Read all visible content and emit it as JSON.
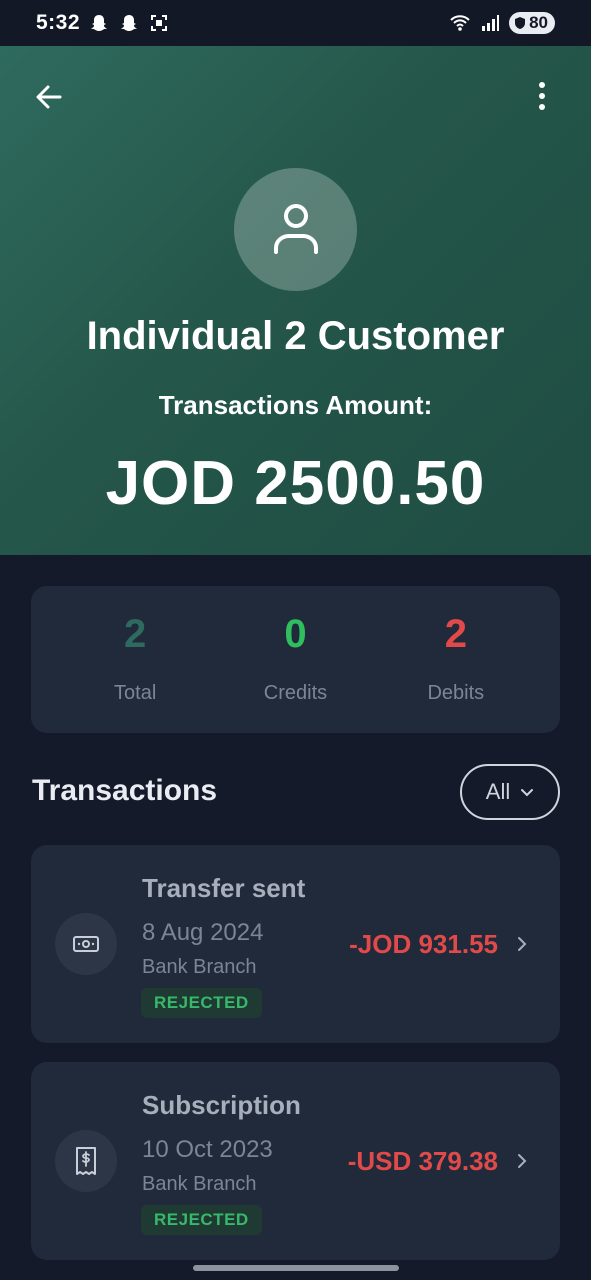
{
  "status_bar": {
    "time": "5:32",
    "battery": "80",
    "icons": [
      "snapchat-icon",
      "snapchat-icon",
      "screenshot-icon",
      "wifi-icon",
      "signal-icon",
      "battery-icon"
    ]
  },
  "header": {
    "customer_name": "Individual 2 Customer",
    "amount_label": "Transactions Amount:",
    "amount_value": "JOD 2500.50"
  },
  "stats": [
    {
      "value": "2",
      "label": "Total",
      "color": "#2f6a5e"
    },
    {
      "value": "0",
      "label": "Credits",
      "color": "#2fbf5e"
    },
    {
      "value": "2",
      "label": "Debits",
      "color": "#e24a4a"
    }
  ],
  "transactions_section": {
    "title": "Transactions",
    "filter_label": "All"
  },
  "transactions": [
    {
      "title": "Transfer sent",
      "date": "8 Aug 2024",
      "channel": "Bank Branch",
      "status": "REJECTED",
      "amount": "-JOD 931.55",
      "icon": "cash-icon"
    },
    {
      "title": "Subscription",
      "date": "10 Oct 2023",
      "channel": "Bank Branch",
      "status": "REJECTED",
      "amount": "-USD 379.38",
      "icon": "receipt-icon"
    }
  ],
  "colors": {
    "background": "#141a2a",
    "header": "#2f6a5e",
    "card": "#212a3a",
    "debit": "#e24a4a",
    "credit": "#2fbf5e",
    "status_rejected": "#38b86b"
  }
}
